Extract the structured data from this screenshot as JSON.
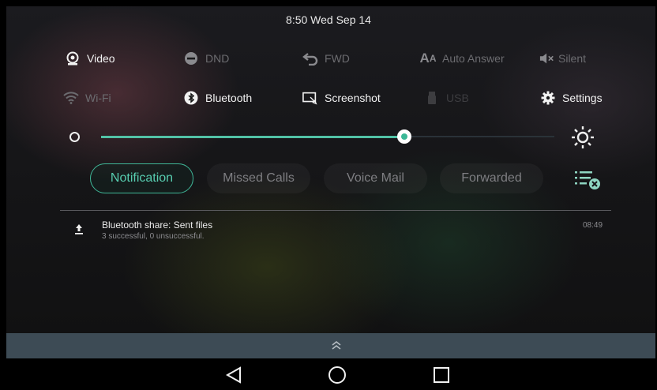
{
  "status": {
    "time": "8:50 Wed Sep 14"
  },
  "quick_settings": {
    "row1": [
      {
        "label": "Video",
        "icon": "video-icon",
        "state": "on"
      },
      {
        "label": "DND",
        "icon": "dnd-icon",
        "state": "off"
      },
      {
        "label": "FWD",
        "icon": "forward-icon",
        "state": "off"
      },
      {
        "label": "Auto Answer",
        "icon": "auto-answer-icon",
        "state": "off"
      },
      {
        "label": "Silent",
        "icon": "mute-icon",
        "state": "off"
      }
    ],
    "row2": [
      {
        "label": "Wi-Fi",
        "icon": "wifi-icon",
        "state": "off"
      },
      {
        "label": "Bluetooth",
        "icon": "bluetooth-icon",
        "state": "on"
      },
      {
        "label": "Screenshot",
        "icon": "screenshot-icon",
        "state": "on"
      },
      {
        "label": "USB",
        "icon": "usb-icon",
        "state": "disabled"
      },
      {
        "label": "Settings",
        "icon": "gear-icon",
        "state": "on"
      }
    ]
  },
  "brightness": {
    "level_fraction": 0.67
  },
  "tabs": [
    {
      "label": "Notification",
      "active": true
    },
    {
      "label": "Missed Calls",
      "active": false
    },
    {
      "label": "Voice Mail",
      "active": false
    },
    {
      "label": "Forwarded",
      "active": false
    }
  ],
  "notifications": [
    {
      "title": "Bluetooth share: Sent files",
      "subtitle": "3 successful, 0 unsuccessful.",
      "time": "08:49",
      "icon": "upload-icon"
    }
  ],
  "colors": {
    "accent": "#3fb697",
    "handle_bar": "#3d4b55",
    "background": "#000000"
  }
}
